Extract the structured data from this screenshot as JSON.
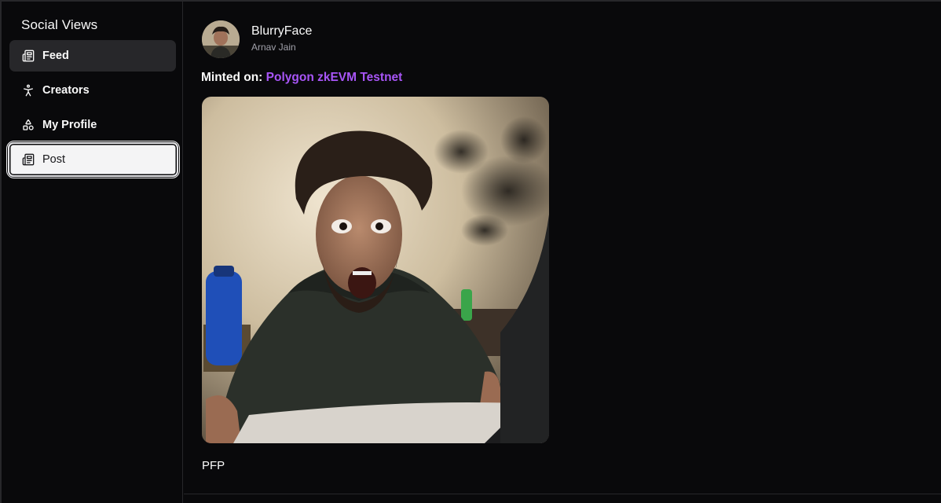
{
  "sidebar": {
    "title": "Social Views",
    "items": [
      {
        "label": "Feed",
        "icon": "newspaper-icon"
      },
      {
        "label": "Creators",
        "icon": "person-icon"
      },
      {
        "label": "My Profile",
        "icon": "shapes-icon"
      },
      {
        "label": "Post",
        "icon": "newspaper-icon"
      }
    ]
  },
  "post": {
    "author_name": "BlurryFace",
    "author_handle": "Arnav Jain",
    "minted_label": "Minted on:",
    "chain": "Polygon zkEVM Testnet",
    "caption": "PFP"
  },
  "colors": {
    "background": "#09090b",
    "border": "#27272a",
    "active_item": "#27272a",
    "selected_item": "#f4f4f5",
    "chain_accent": "#a855f7"
  }
}
